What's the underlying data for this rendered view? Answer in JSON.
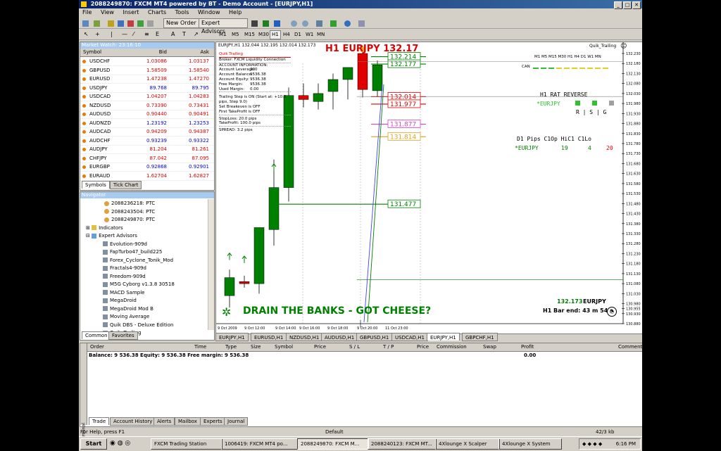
{
  "window": {
    "title": "2088249870: FXCM MT4 powered by BT - Demo Account - [EURJPY,H1]"
  },
  "menu": [
    "File",
    "View",
    "Insert",
    "Charts",
    "Tools",
    "Window",
    "Help"
  ],
  "toolbar": {
    "new_order": "New Order",
    "expert_advisors": "Expert Advisors",
    "timeframes": [
      "M1",
      "M5",
      "M15",
      "M30",
      "H1",
      "H4",
      "D1",
      "W1",
      "MN"
    ],
    "active_timeframe": "H1"
  },
  "market_watch": {
    "title": "Market Watch: 23:16:10",
    "headers": {
      "symbol": "Symbol",
      "bid": "Bid",
      "ask": "Ask"
    },
    "rows": [
      {
        "symbol": "USDCHF",
        "bid": "1.03086",
        "ask": "1.03137",
        "dir": "dn"
      },
      {
        "symbol": "GBPUSD",
        "bid": "1.58509",
        "ask": "1.58540",
        "dir": "dn"
      },
      {
        "symbol": "EURUSD",
        "bid": "1.47238",
        "ask": "1.47270",
        "dir": "dn"
      },
      {
        "symbol": "USDJPY",
        "bid": "89.768",
        "ask": "89.795",
        "dir": "up"
      },
      {
        "symbol": "USDCAD",
        "bid": "1.04207",
        "ask": "1.04283",
        "dir": "dn"
      },
      {
        "symbol": "NZDUSD",
        "bid": "0.73390",
        "ask": "0.73431",
        "dir": "dn"
      },
      {
        "symbol": "AUDUSD",
        "bid": "0.90440",
        "ask": "0.90491",
        "dir": "dn"
      },
      {
        "symbol": "AUDNZD",
        "bid": "1.23192",
        "ask": "1.23253",
        "dir": "up"
      },
      {
        "symbol": "AUDCAD",
        "bid": "0.94209",
        "ask": "0.94387",
        "dir": "dn"
      },
      {
        "symbol": "AUDCHF",
        "bid": "0.93239",
        "ask": "0.93322",
        "dir": "up"
      },
      {
        "symbol": "AUDJPY",
        "bid": "81.204",
        "ask": "81.261",
        "dir": "dn"
      },
      {
        "symbol": "CHFJPY",
        "bid": "87.042",
        "ask": "87.095",
        "dir": "dn"
      },
      {
        "symbol": "EURGBP",
        "bid": "0.92868",
        "ask": "0.92901",
        "dir": "up"
      },
      {
        "symbol": "EURAUD",
        "bid": "1.62704",
        "ask": "1.62827",
        "dir": "dn"
      }
    ],
    "tabs": [
      "Symbols",
      "Tick Chart"
    ]
  },
  "navigator": {
    "title": "Navigator",
    "accounts": [
      "2088236218: PTC",
      "2088243504: PTC",
      "2088249870: PTC"
    ],
    "indicators_label": "Indicators",
    "experts_label": "Expert Advisors",
    "experts": [
      "Evolution-909d",
      "FapTurbo47_build225",
      "Forex_Cyclone_Tonik_Mod",
      "Fractals4-909d",
      "Freedom-909d",
      "M5G Cyborg v1.3.8 30518",
      "MACD Sample",
      "MegaDroid",
      "MegaDroid Mod B",
      "Moving Average",
      "Quik DBS - Deluxe Edition",
      "Quik_Trailing"
    ],
    "tabs": [
      "Common",
      "Favorites"
    ]
  },
  "chart": {
    "header": "EURJPY,H1  132.044 132.195 132.014 132.173",
    "big_label": "H1 EURJPY 132.17",
    "ea_name": "Quik_Trailing",
    "info": {
      "ea_label": "Quik Trailing",
      "broker": "Broker: FXCM Liquidity Connection",
      "account_info": "ACCOUNT INFORMATION:",
      "leverage_label": "Account Leverage:",
      "leverage": "200",
      "balance_label": "Account Balance:",
      "balance": "9536.38",
      "equity_label": "Account Equity:",
      "equity": "9536.38",
      "free_margin_label": "Free Margin:",
      "free_margin": "9536.38",
      "used_margin_label": "Used Margin:",
      "used_margin": "0.00",
      "trailing": "Trailing Step is ON (Start at: +10.0 pips, Step 9.0)",
      "breakeven": "Set Breakeven is OFF",
      "first_tp": "First TakeProfit is OFF",
      "stoploss": "StopLoss: 20.0 pips",
      "takeprofit": "TakeProfit: 100.0 pips",
      "spread": "SPREAD:  3.2  pips"
    },
    "tf_row": "M1 M5 M15 M30  H1  H4  D1  W1 MN",
    "can_label": "CAN",
    "rat": {
      "title": "H1 RAT REVERSE",
      "symbol": "*EURJPY",
      "cols": "R | S | G"
    },
    "d1": {
      "header": "D1 Pips  C1Op HiC1 C1Lo",
      "symbol": "*EURJPY",
      "v1": "19",
      "v2": "4",
      "v3": "20"
    },
    "price_tag": "132.173",
    "price_sym": "EURJPY",
    "bar_end": "H1 Bar end: 43 m 54 s",
    "slogan": "DRAIN THE BANKS - GOT CHEESE?",
    "levels": [
      "132.214",
      "132.177",
      "132.014",
      "131.977",
      "131.877",
      "131.814",
      "131.477"
    ],
    "axis": [
      "132.230",
      "132.180",
      "132.130",
      "132.080",
      "132.030",
      "131.980",
      "131.930",
      "131.880",
      "131.830",
      "131.780",
      "131.730",
      "131.680",
      "131.630",
      "131.580",
      "131.530",
      "131.480",
      "131.430",
      "131.380",
      "131.330",
      "131.280",
      "131.230",
      "131.180",
      "131.130",
      "131.080",
      "131.030",
      "130.980",
      "130.955",
      "130.930",
      "130.880"
    ],
    "time_labels": [
      "9 Oct 2009",
      "9 Oct 12:00",
      "9 Oct 14:00",
      "9 Oct 16:00",
      "9 Oct 18:00",
      "9 Oct 20:00",
      "11 Oct 23:00"
    ],
    "colors": {
      "bull": "#008000",
      "bear": "#e00000",
      "levels_green": "#008000",
      "levels_red": "#e00000",
      "levels_pink": "#e040c0",
      "levels_orange": "#e0a020"
    }
  },
  "chart_tabs": [
    "EURJPY,H1",
    "EURUSD,H1",
    "NZDUSD,H1",
    "AUDUSD,H1",
    "GBPUSD,H1",
    "USDCAD,H1",
    "EURJPY,H1",
    "GBPCHF,H1"
  ],
  "active_chart_tab": "EURJPY,H1",
  "terminal": {
    "headers": [
      "Order",
      "Time",
      "Type",
      "Size",
      "Symbol",
      "Price",
      "S / L",
      "T / P",
      "Price",
      "Commission",
      "Swap",
      "Profit",
      "Comment"
    ],
    "balance_line": "Balance: 9 536.38  Equity: 9 536.38  Free margin: 9 536.38",
    "profit": "0.00",
    "tabs": [
      "Trade",
      "Account History",
      "Alerts",
      "Mailbox",
      "Experts",
      "Journal"
    ],
    "side_label": "Terminal"
  },
  "status": {
    "help": "For Help, press F1",
    "profile": "Default",
    "conn": "42/3 kb"
  },
  "taskbar": {
    "start": "Start",
    "tasks": [
      "FXCM Trading Station",
      "1006419: FXCM MT4 po...",
      "2088249870: FXCM M...",
      "2088240123: FXCM MT...",
      "4Xlounge X Scalper",
      "4Xlounge X System"
    ],
    "active_task": 2,
    "clock": "6:16 PM"
  }
}
